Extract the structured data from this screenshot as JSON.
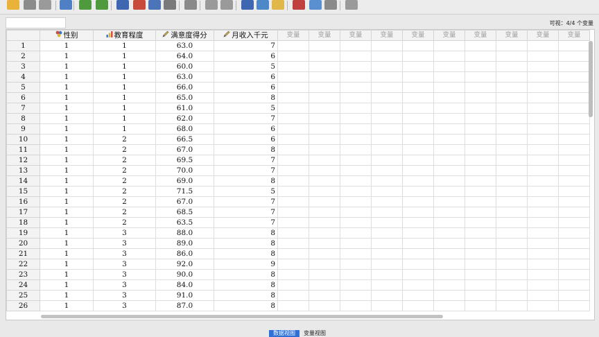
{
  "status": {
    "visible_count": "可视：4/4 个变量"
  },
  "columns": [
    {
      "label": "性别",
      "icon": "nominal-measure-icon",
      "align": "c"
    },
    {
      "label": "教育程度",
      "icon": "ordinal-measure-icon",
      "align": "c"
    },
    {
      "label": "满意度得分",
      "icon": "scale-measure-icon",
      "align": "c"
    },
    {
      "label": "月收入千元",
      "icon": "scale-measure-icon",
      "align": "r"
    }
  ],
  "empty_column_label": "变量",
  "empty_columns": 10,
  "rows": [
    [
      "1",
      "1",
      "1",
      "63.0",
      "7"
    ],
    [
      "2",
      "1",
      "1",
      "64.0",
      "6"
    ],
    [
      "3",
      "1",
      "1",
      "60.0",
      "5"
    ],
    [
      "4",
      "1",
      "1",
      "63.0",
      "6"
    ],
    [
      "5",
      "1",
      "1",
      "66.0",
      "6"
    ],
    [
      "6",
      "1",
      "1",
      "65.0",
      "8"
    ],
    [
      "7",
      "1",
      "1",
      "61.0",
      "5"
    ],
    [
      "8",
      "1",
      "1",
      "62.0",
      "7"
    ],
    [
      "9",
      "1",
      "1",
      "68.0",
      "6"
    ],
    [
      "10",
      "1",
      "2",
      "66.5",
      "6"
    ],
    [
      "11",
      "1",
      "2",
      "67.0",
      "8"
    ],
    [
      "12",
      "1",
      "2",
      "69.5",
      "7"
    ],
    [
      "13",
      "1",
      "2",
      "70.0",
      "7"
    ],
    [
      "14",
      "1",
      "2",
      "69.0",
      "8"
    ],
    [
      "15",
      "1",
      "2",
      "71.5",
      "5"
    ],
    [
      "16",
      "1",
      "2",
      "67.0",
      "7"
    ],
    [
      "17",
      "1",
      "2",
      "68.5",
      "7"
    ],
    [
      "18",
      "1",
      "2",
      "63.5",
      "7"
    ],
    [
      "19",
      "1",
      "3",
      "88.0",
      "8"
    ],
    [
      "20",
      "1",
      "3",
      "89.0",
      "8"
    ],
    [
      "21",
      "1",
      "3",
      "86.0",
      "8"
    ],
    [
      "22",
      "1",
      "3",
      "92.0",
      "9"
    ],
    [
      "23",
      "1",
      "3",
      "90.0",
      "8"
    ],
    [
      "24",
      "1",
      "3",
      "84.0",
      "8"
    ],
    [
      "25",
      "1",
      "3",
      "91.0",
      "8"
    ],
    [
      "26",
      "1",
      "3",
      "87.0",
      "8"
    ]
  ],
  "tabs": [
    {
      "label": "数据视图",
      "active": true
    },
    {
      "label": "变量视图",
      "active": false
    }
  ],
  "toolbar": [
    {
      "name": "open-folder-icon",
      "color": "#e9b23b"
    },
    {
      "name": "save-icon",
      "color": "#8c8c8c"
    },
    {
      "name": "print-icon",
      "color": "#9a9a9a"
    },
    {
      "name": "dialog-recall-icon",
      "color": "#4f7fc4"
    },
    {
      "name": "undo-icon",
      "color": "#4f9a3c"
    },
    {
      "name": "redo-icon",
      "color": "#4f9a3c"
    },
    {
      "name": "goto-case-icon",
      "color": "#3f66b0"
    },
    {
      "name": "goto-variable-icon",
      "color": "#c84a3a"
    },
    {
      "name": "variables-icon",
      "color": "#4c74b8"
    },
    {
      "name": "find-icon",
      "color": "#7a7a7a"
    },
    {
      "name": "insert-cases-icon",
      "color": "#8a8a8a"
    },
    {
      "name": "insert-variable-icon",
      "color": "#9a9a9a"
    },
    {
      "name": "split-file-icon",
      "color": "#9a9a9a"
    },
    {
      "name": "weight-cases-icon",
      "color": "#3f66b0"
    },
    {
      "name": "select-cases-icon",
      "color": "#4d88c8"
    },
    {
      "name": "value-labels-icon",
      "color": "#e0b84a"
    },
    {
      "name": "use-sets-icon",
      "color": "#c04040"
    },
    {
      "name": "show-all-icon",
      "color": "#5a8fd0"
    },
    {
      "name": "spelling-icon",
      "color": "#8a8a8a"
    },
    {
      "name": "abc-check-icon",
      "color": "#9a9a9a"
    }
  ]
}
